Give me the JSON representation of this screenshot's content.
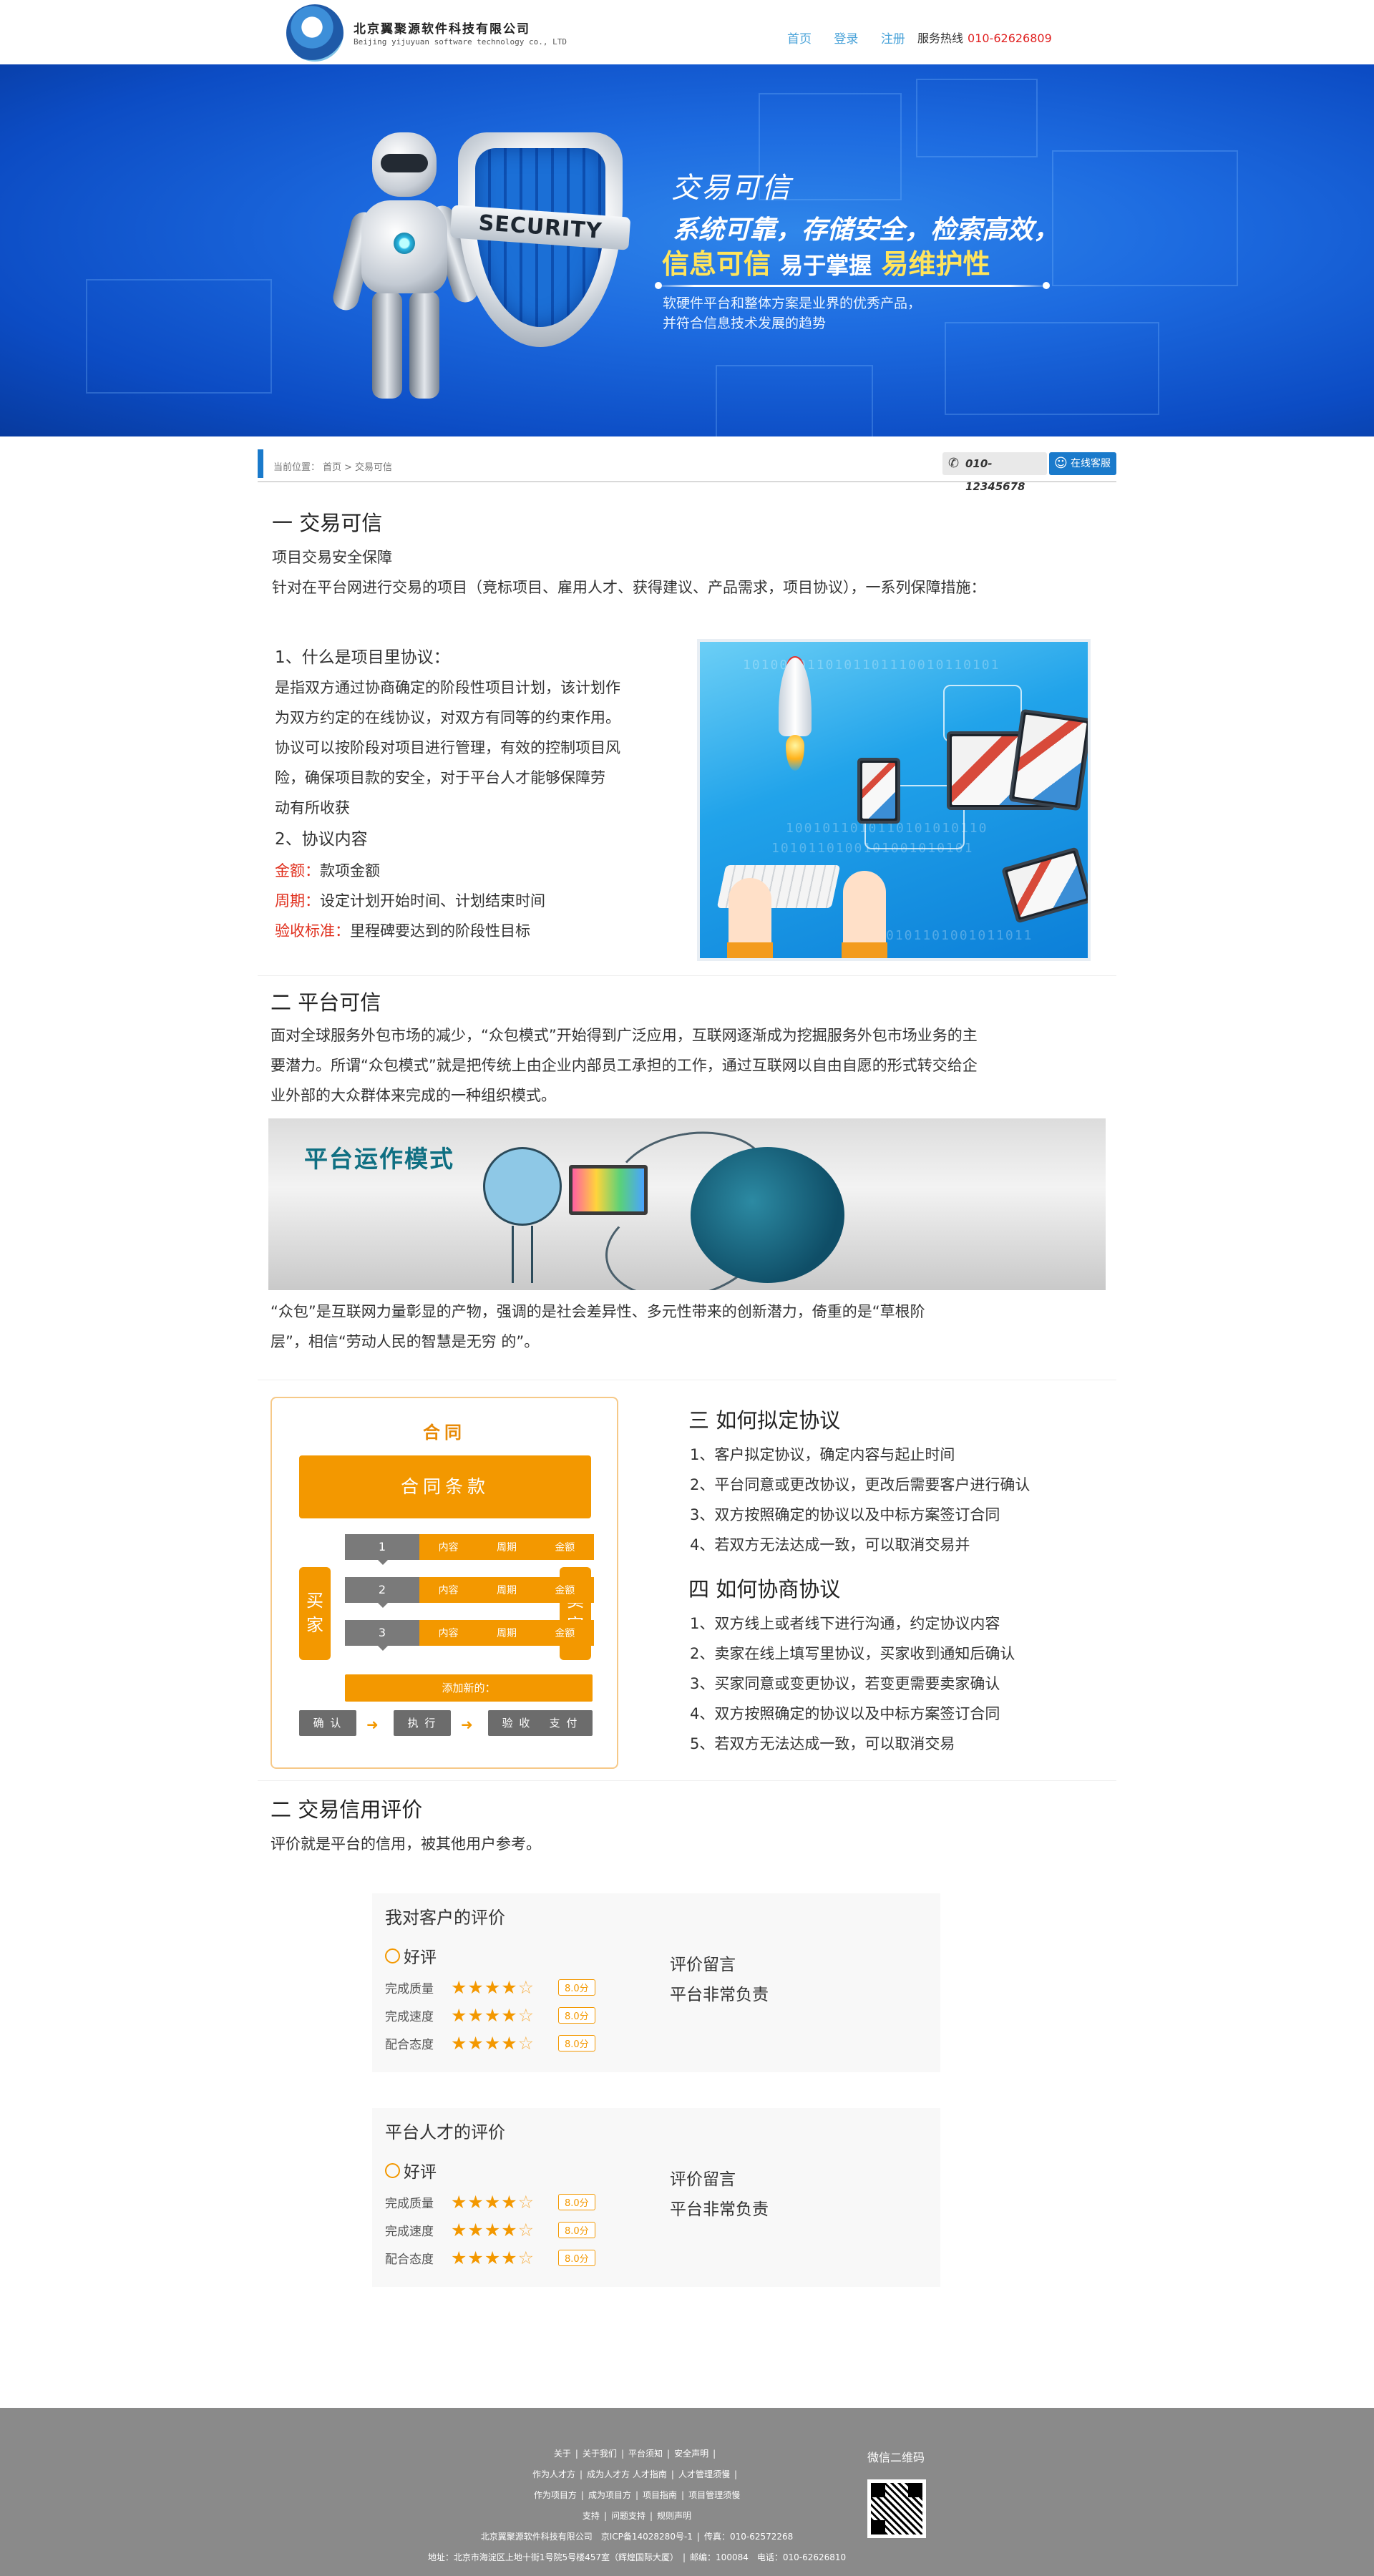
{
  "header": {
    "company_cn": "北京翼聚源软件科技有限公司",
    "company_en": "Beijing yijuyuan software technology co., LTD",
    "nav": [
      "首页",
      "登录",
      "注册"
    ],
    "hotline_label": "服务热线",
    "hotline_number": "010-62626809"
  },
  "banner": {
    "title": "交易可信",
    "line1": "系统可靠，存储安全，检索高效，",
    "line2_a": "信息可信",
    "line2_b": "易于掌握",
    "line2_c": "易维护性",
    "desc": [
      "软硬件平台和整体方案是业界的优秀产品，",
      "并符合信息技术发展的趋势"
    ],
    "shield_text": "SECURITY"
  },
  "breadcrumb": {
    "label": "当前位置：",
    "home": "首页",
    "sep": ">",
    "current": "交易可信",
    "phone": "010-12345678",
    "online": "在线客服"
  },
  "sec1": {
    "title": "一 交易可信",
    "sub": "项目交易安全保障",
    "intro": "针对在平台网进行交易的项目（竞标项目、雇用人才、获得建议、产品需求，项目协议），一系列保障措施：",
    "q1": "1、什么是项目里协议：",
    "q1_body": [
      "是指双方通过协商确定的阶段性项目计划，该计划作",
      "为双方约定的在线协议，对双方有同等的约束作用。",
      "协议可以按阶段对项目进行管理，有效的控制项目风",
      "险，确保项目款的安全，对于平台人才能够保障劳",
      "动有所收获"
    ],
    "q2": "2、协议内容",
    "items": [
      {
        "key": "金额：",
        "val": "款项金额"
      },
      {
        "key": "周期：",
        "val": "设定计划开始时间、计划结束时间"
      },
      {
        "key": "验收标准：",
        "val": "里程碑要达到的阶段性目标"
      }
    ]
  },
  "sec2": {
    "title": "二 平台可信",
    "body": [
      "面对全球服务外包市场的减少，“众包模式”开始得到广泛应用，互联网逐渐成为挖掘服务外包市场业务的主",
      "要潜力。所谓“众包模式”就是把传统上由企业内部员工承担的工作，通过互联网以自由自愿的形式转交给企",
      "业外部的大众群体来完成的一种组织模式。"
    ],
    "image_title": "平台运作模式",
    "caption": [
      "“众包”是互联网力量彰显的产物，强调的是社会差异性、多元性带来的创新潜力，倚重的是“草根阶",
      "层”，相信“劳动人民的智慧是无穷 的”。"
    ]
  },
  "contract": {
    "title": "合同",
    "main": "合同条款",
    "buyer": [
      "买",
      "家"
    ],
    "seller": [
      "卖",
      "家"
    ],
    "rows": [
      {
        "num": "1",
        "cells": [
          "内容",
          "周期",
          "金额"
        ]
      },
      {
        "num": "2",
        "cells": [
          "内容",
          "周期",
          "金额"
        ]
      },
      {
        "num": "3",
        "cells": [
          "内容",
          "周期",
          "金额"
        ]
      }
    ],
    "add": "添加新的：",
    "steps": [
      "确 认",
      "执 行",
      "验 收",
      "支 付"
    ]
  },
  "sec3": {
    "title": "三 如何拟定协议",
    "items": [
      "1、客户拟定协议，确定内容与起止时间",
      "2、平台同意或更改协议，更改后需要客户进行确认",
      "3、双方按照确定的协议以及中标方案签订合同",
      "4、若双方无法达成一致，可以取消交易并"
    ]
  },
  "sec4": {
    "title": "四 如何协商协议",
    "items": [
      "1、双方线上或者线下进行沟通，约定协议内容",
      "2、卖家在线上填写里协议，买家收到通知后确认",
      "3、买家同意或变更协议，若变更需要卖家确认",
      "4、双方按照确定的协议以及中标方案签订合同",
      "5、若双方无法达成一致，可以取消交易"
    ]
  },
  "sec5": {
    "title": "二 交易信用评价",
    "intro": "评价就是平台的信用，被其他用户参考。"
  },
  "ratings": [
    {
      "title": "我对客户的评价",
      "grade": "好评",
      "rows": [
        {
          "label": "完成质量",
          "stars": 4,
          "score": "8.0分"
        },
        {
          "label": "完成速度",
          "stars": 4,
          "score": "8.0分"
        },
        {
          "label": "配合态度",
          "stars": 4,
          "score": "8.0分"
        }
      ],
      "comment_label": "评价留言",
      "comment": "平台非常负责"
    },
    {
      "title": "平台人才的评价",
      "grade": "好评",
      "rows": [
        {
          "label": "完成质量",
          "stars": 4,
          "score": "8.0分"
        },
        {
          "label": "完成速度",
          "stars": 4,
          "score": "8.0分"
        },
        {
          "label": "配合态度",
          "stars": 4,
          "score": "8.0分"
        }
      ],
      "comment_label": "评价留言",
      "comment": "平台非常负责"
    }
  ],
  "footer": {
    "row1": [
      "关于",
      "关于我们",
      "平台须知",
      "安全声明"
    ],
    "row2": [
      "作为人才方",
      "成为人才方 人才指南",
      "人才管理须慢"
    ],
    "row3": [
      "作为项目方",
      "成为项目方",
      "项目指南",
      "项目管理须慢"
    ],
    "row4": [
      "支持",
      "问题支持",
      "规则声明"
    ],
    "company": "北京翼聚源软件科技有限公司",
    "icp": "京ICP备14028280号-1",
    "fax": "传真：010-62572268",
    "address": "地址：北京市海淀区上地十街1号院5号楼457室（辉煌国际大厦）",
    "postcode": "邮编：100084",
    "phone": "电话：010-62626810",
    "qr_title": "微信二维码"
  }
}
